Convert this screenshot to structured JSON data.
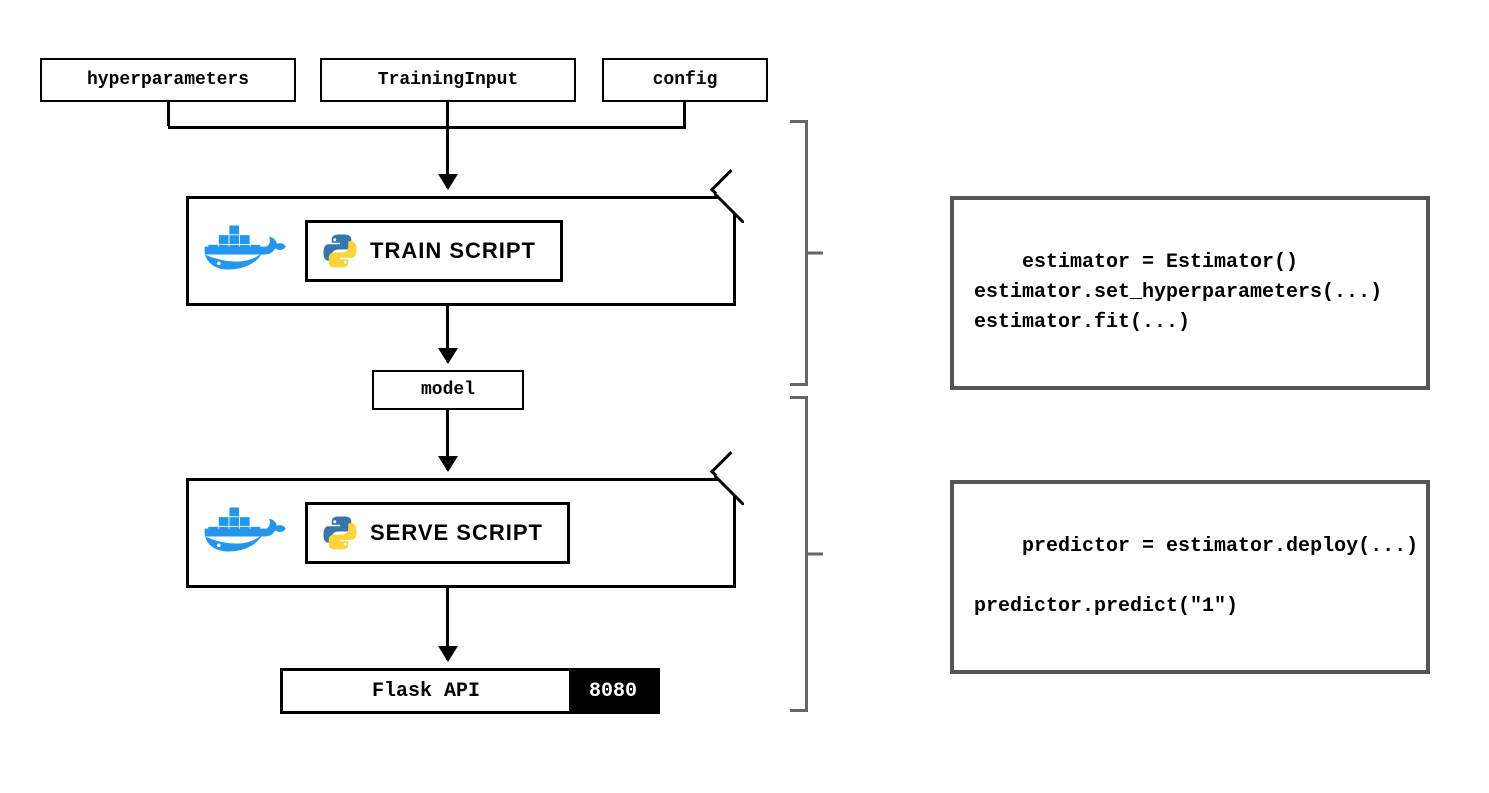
{
  "inputs": {
    "hyperparameters": "hyperparameters",
    "training_input": "TrainingInput",
    "config": "config"
  },
  "train": {
    "label": "TRAIN SCRIPT"
  },
  "model": {
    "label": "model"
  },
  "serve": {
    "label": "SERVE SCRIPT"
  },
  "flask": {
    "label": "Flask API",
    "port": "8080"
  },
  "code": {
    "train_block": "estimator = Estimator()\nestimator.set_hyperparameters(...)\nestimator.fit(...)",
    "serve_block": "predictor = estimator.deploy(...)\n\npredictor.predict(\"1\")"
  }
}
